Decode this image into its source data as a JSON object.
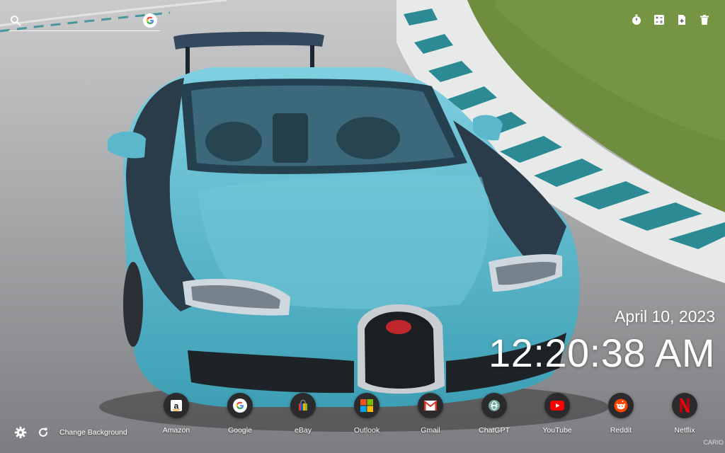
{
  "search": {
    "placeholder": "",
    "value": ""
  },
  "clock": {
    "date": "April 10, 2023",
    "time": "12:20:38 AM"
  },
  "bottom": {
    "change_background": "Change Background"
  },
  "dock": [
    {
      "label": "Amazon"
    },
    {
      "label": "Google"
    },
    {
      "label": "eBay"
    },
    {
      "label": "Outlook"
    },
    {
      "label": "Gmail"
    },
    {
      "label": "ChatGPT"
    },
    {
      "label": "YouTube"
    },
    {
      "label": "Reddit"
    },
    {
      "label": "Netflix"
    }
  ],
  "credit": "CARIO",
  "colors": {
    "car_body": "#5bb8cc",
    "car_dark": "#2a3b4a",
    "curb_teal": "#2c8a94",
    "grass": "#6d8c3c"
  }
}
